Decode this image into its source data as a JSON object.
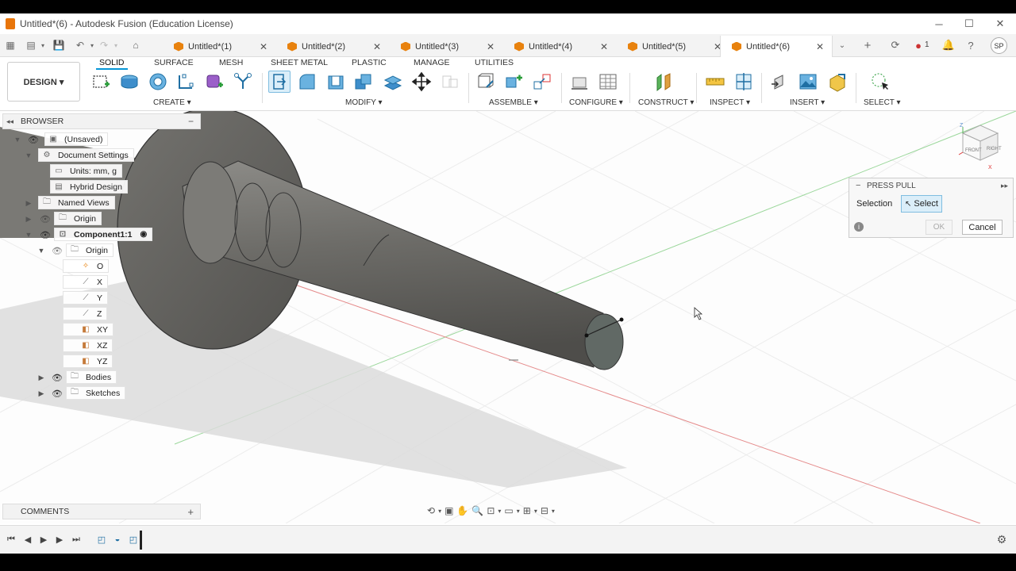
{
  "window": {
    "title": "Untitled*(6) - Autodesk Fusion (Education License)"
  },
  "tabs": [
    {
      "label": "Untitled*(1)"
    },
    {
      "label": "Untitled*(2)"
    },
    {
      "label": "Untitled*(3)"
    },
    {
      "label": "Untitled*(4)"
    },
    {
      "label": "Untitled*(5)"
    },
    {
      "label": "Untitled*(6)"
    }
  ],
  "topright": {
    "notifications": "1",
    "user_initials": "SP"
  },
  "workspace": {
    "label": "DESIGN ▾"
  },
  "ribbon_tabs": [
    "SOLID",
    "SURFACE",
    "MESH",
    "SHEET METAL",
    "PLASTIC",
    "MANAGE",
    "UTILITIES"
  ],
  "ribbon_groups": [
    "CREATE ▾",
    "MODIFY ▾",
    "ASSEMBLE ▾",
    "CONFIGURE ▾",
    "CONSTRUCT ▾",
    "INSPECT ▾",
    "INSERT ▾",
    "SELECT ▾"
  ],
  "browser": {
    "title": "BROWSER",
    "nodes": [
      "(Unsaved)",
      "Document Settings",
      "Units: mm, g",
      "Hybrid Design",
      "Named Views",
      "Origin",
      "Component1:1",
      "Origin",
      "O",
      "X",
      "Y",
      "Z",
      "XY",
      "XZ",
      "YZ",
      "Bodies",
      "Sketches"
    ]
  },
  "press_pull": {
    "title": "PRESS PULL",
    "selection_label": "Selection",
    "select_button": "Select",
    "ok": "OK",
    "cancel": "Cancel"
  },
  "comments": {
    "title": "COMMENTS"
  },
  "viewcube": {
    "front": "FRONT",
    "right": "RIGHT",
    "z": "Z",
    "x": "X"
  },
  "colors": {
    "accent": "#0696d7",
    "body_grey": "#6f6e6a",
    "ribbon_bg": "#ffffff"
  }
}
